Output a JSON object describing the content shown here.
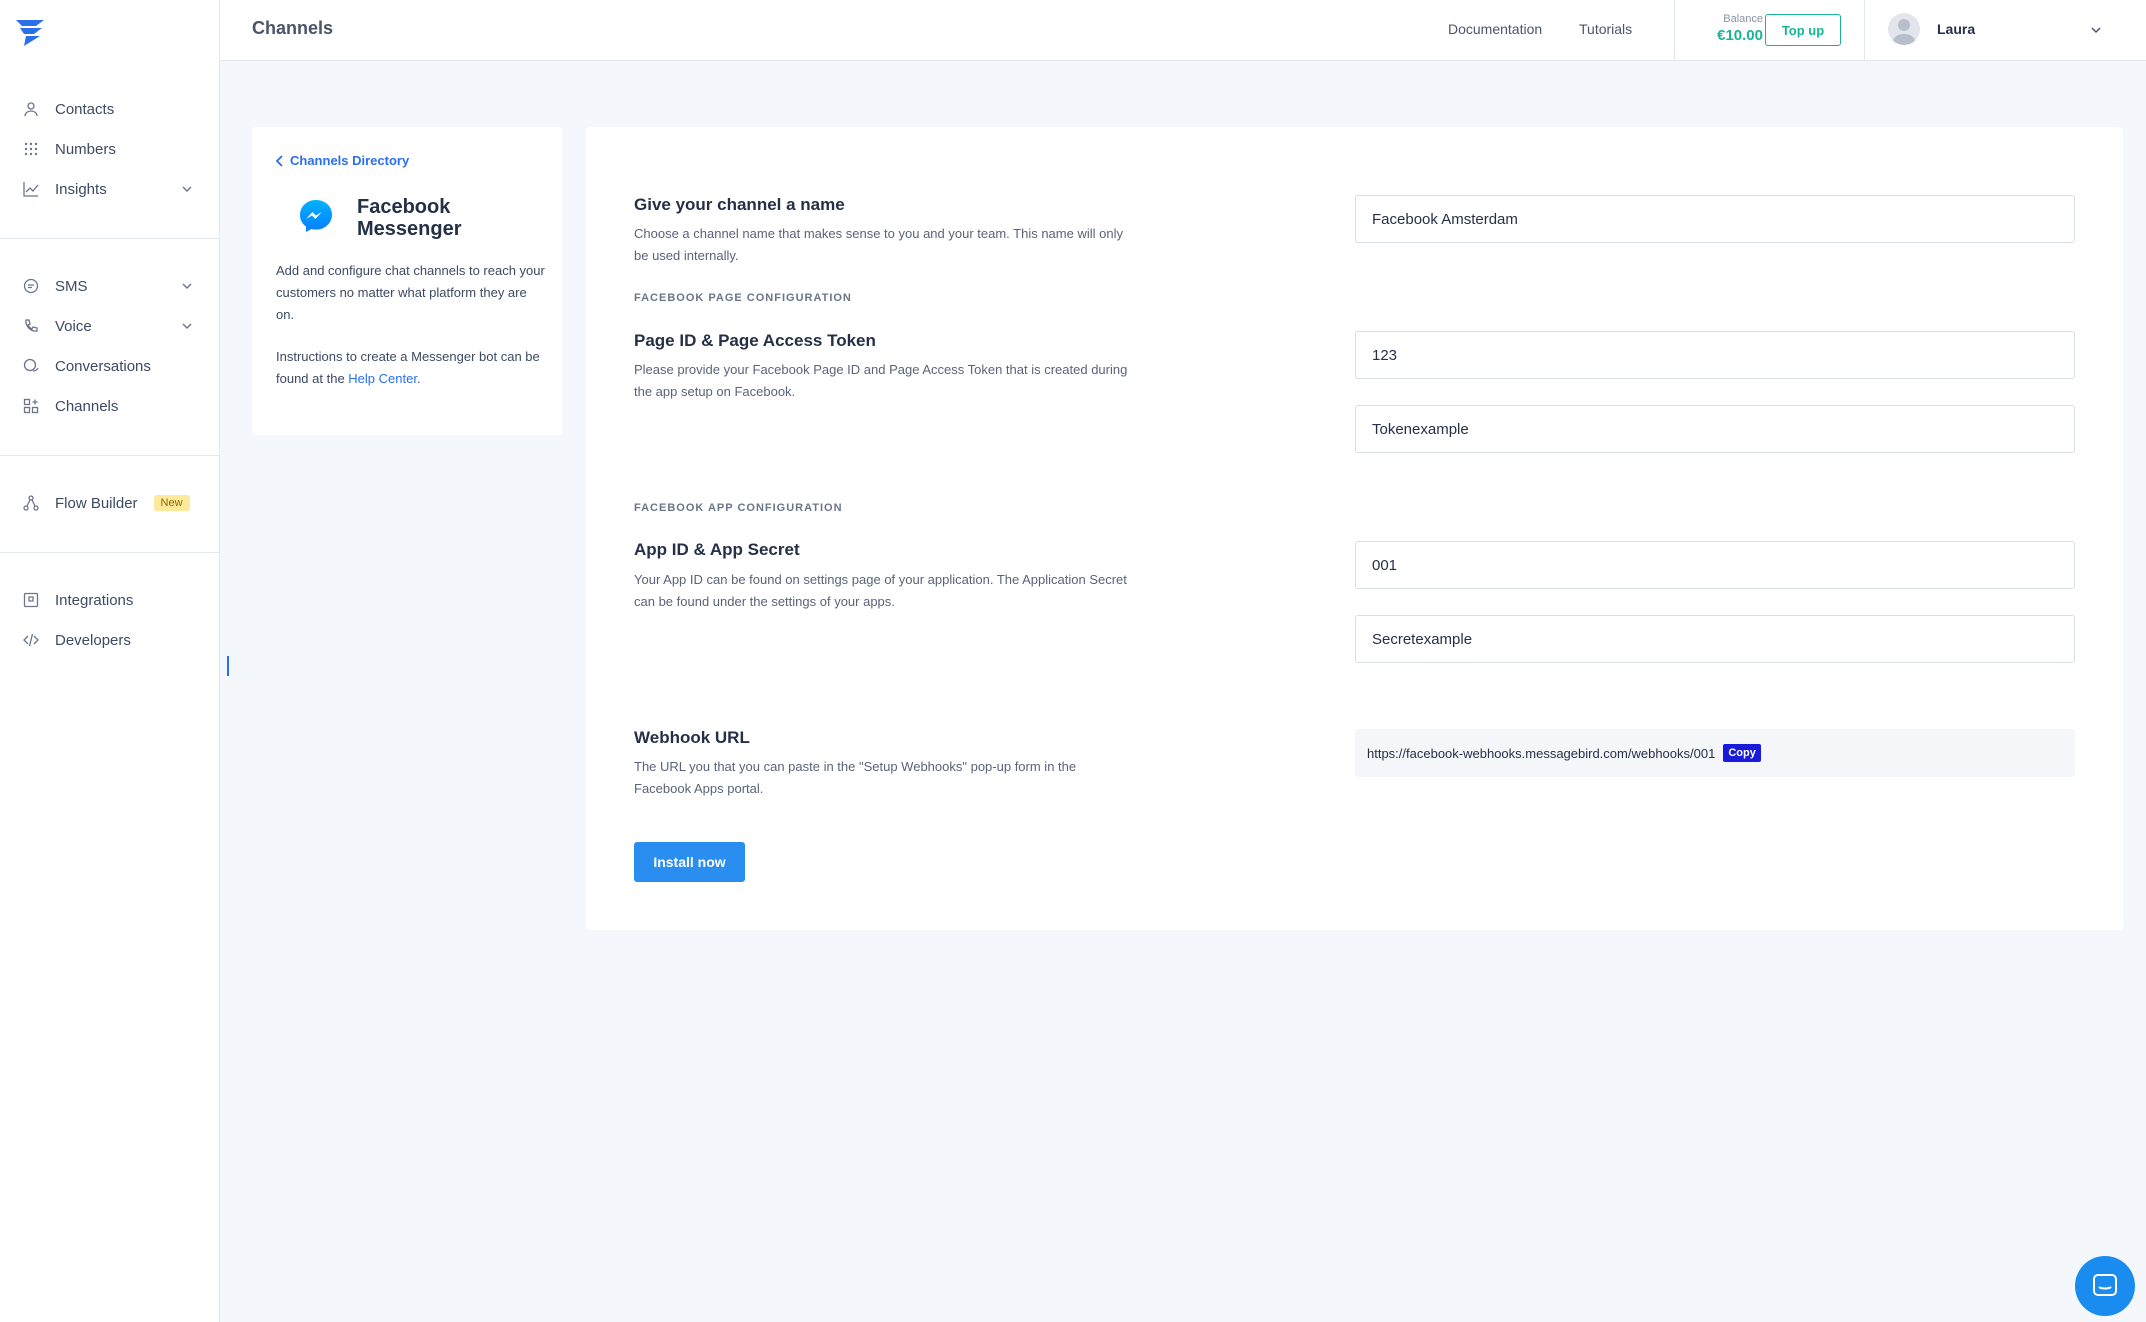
{
  "app": {
    "colors": {
      "accent": "#2b6fea",
      "balance": "#17b596",
      "primary_button": "#2a8ef0",
      "copy_button": "#1a1adb",
      "new_badge": "#ffe99a"
    }
  },
  "sidebar": {
    "logo": "messagebird-logo",
    "group1": [
      {
        "label": "Contacts",
        "icon": "user-icon"
      },
      {
        "label": "Numbers",
        "icon": "grid-icon"
      },
      {
        "label": "Insights",
        "icon": "chart-icon",
        "has_chevron": true
      }
    ],
    "group2": [
      {
        "label": "SMS",
        "icon": "sms-icon",
        "has_chevron": true
      },
      {
        "label": "Voice",
        "icon": "phone-icon",
        "has_chevron": true
      },
      {
        "label": "Conversations",
        "icon": "chat-icon"
      },
      {
        "label": "Channels",
        "icon": "channels-icon"
      }
    ],
    "group3": [
      {
        "label": "Flow Builder",
        "icon": "flow-icon",
        "badge": "New"
      }
    ],
    "group4": [
      {
        "label": "Integrations",
        "icon": "integrations-icon"
      },
      {
        "label": "Developers",
        "icon": "code-icon"
      }
    ]
  },
  "header": {
    "title": "Channels",
    "links": [
      "Documentation",
      "Tutorials"
    ],
    "balance_label": "Balance",
    "balance_value": "€10.00",
    "topup_label": "Top up",
    "user_name": "Laura"
  },
  "info_card": {
    "back_label": "Channels Directory",
    "channel_name_line1": "Facebook",
    "channel_name_line2": "Messenger",
    "description": "Add and configure chat channels to reach your customers no matter what platform they are on.",
    "instructions_prefix": "Instructions to create a Messenger bot can be found at the ",
    "help_link": "Help Center",
    "instructions_suffix": "."
  },
  "form": {
    "name_section": {
      "title": "Give your channel a name",
      "description": "Choose a channel name that makes sense to you and your team. This name will only be used internally.",
      "value": "Facebook Amsterdam"
    },
    "page_config_label": "FACEBOOK PAGE CONFIGURATION",
    "page_section": {
      "title": "Page ID & Page Access Token",
      "description": "Please provide your Facebook Page ID and Page Access Token that is created during the app setup on Facebook.",
      "page_id": "123",
      "token": "Tokenexample"
    },
    "app_config_label": "FACEBOOK APP CONFIGURATION",
    "app_section": {
      "title": "App ID & App Secret",
      "description": "Your App ID can be found on settings page of your application. The Application Secret can be found under the settings of your apps.",
      "app_id": "001",
      "secret": "Secretexample"
    },
    "webhook_section": {
      "title": "Webhook URL",
      "description": "The URL you that you can paste in the \"Setup Webhooks\" pop-up form in the Facebook Apps portal.",
      "url": "https://facebook-webhooks.messagebird.com/webhooks/001",
      "copy_label": "Copy"
    },
    "install_label": "Install now"
  }
}
